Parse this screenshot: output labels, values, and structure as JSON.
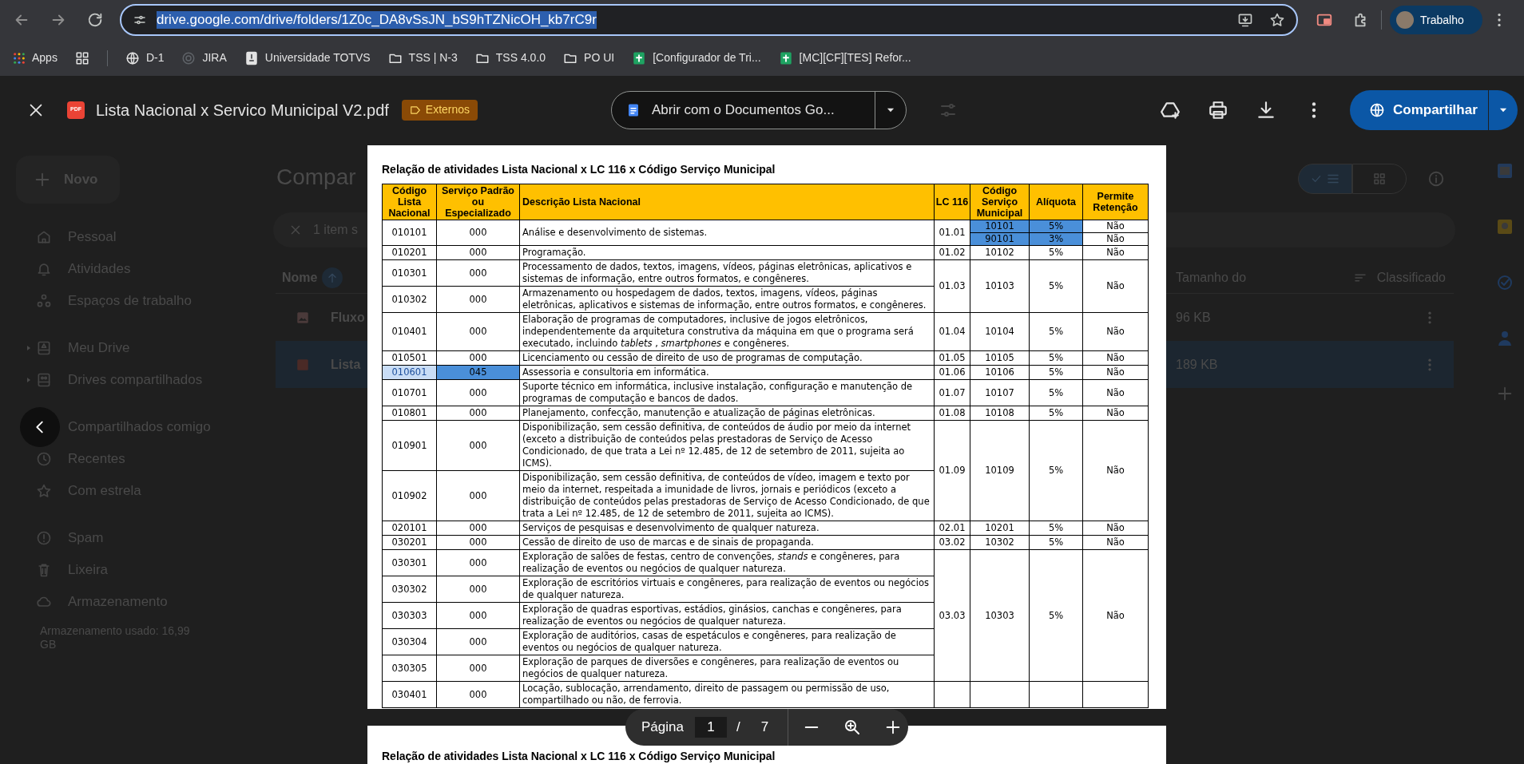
{
  "browser": {
    "url": "drive.google.com/drive/folders/1Z0c_DA8vSsJN_bS9hTZNicOH_kb7rC9r",
    "url_selected": true,
    "profile": "Trabalho"
  },
  "bookmarks": [
    {
      "kind": "apps",
      "label": "Apps"
    },
    {
      "kind": "grid"
    },
    {
      "kind": "globe",
      "label": "D-1"
    },
    {
      "kind": "site",
      "label": "JIRA"
    },
    {
      "kind": "page",
      "label": "Universidade TOTVS"
    },
    {
      "kind": "folder",
      "label": "TSS | N-3"
    },
    {
      "kind": "folder",
      "label": "TSS 4.0.0"
    },
    {
      "kind": "folder",
      "label": "PO UI"
    },
    {
      "kind": "sheet",
      "label": "[Configurador de Tri..."
    },
    {
      "kind": "sheet",
      "label": "[MC][CF][TES] Refor..."
    }
  ],
  "viewer": {
    "file_type": "PDF",
    "file_name": "Lista Nacional x Servico Municipal V2.pdf",
    "badge": "Externos",
    "open_with": "Abrir com o Documentos Go...",
    "share": "Compartilhar"
  },
  "drive": {
    "new_button": "Novo",
    "sections": [
      {
        "items": [
          {
            "label": "Pessoal",
            "kind": "home",
            "expandable": false
          },
          {
            "label": "Atividades",
            "kind": "bell",
            "expandable": false
          },
          {
            "label": "Espaços de trabalho",
            "kind": "circles",
            "expandable": false
          }
        ]
      },
      {
        "items": [
          {
            "label": "Meu Drive",
            "kind": "drive",
            "expandable": true
          },
          {
            "label": "Drives compartilhados",
            "kind": "shared",
            "expandable": true
          }
        ]
      },
      {
        "items": [
          {
            "label": "Compartilhados comigo",
            "kind": "covered",
            "expandable": false
          },
          {
            "label": "Recentes",
            "kind": "clock",
            "expandable": false
          },
          {
            "label": "Com estrela",
            "kind": "star",
            "expandable": false
          }
        ]
      },
      {
        "items": [
          {
            "label": "Spam",
            "kind": "alert",
            "expandable": false
          },
          {
            "label": "Lixeira",
            "kind": "trash",
            "expandable": false
          },
          {
            "label": "Armazenamento",
            "kind": "cloud",
            "expandable": false
          }
        ]
      }
    ],
    "storage_used": "Armazenamento usado: 16,99 GB",
    "page_title": "Compar",
    "selection": "1 item s",
    "views": [
      {
        "kind": "list",
        "selected": true
      },
      {
        "kind": "grid",
        "selected": false
      }
    ],
    "columns": [
      "Nome",
      "Tamanho do",
      "Classificado"
    ],
    "files": [
      {
        "name": "Fluxo",
        "kind": "image",
        "size": "96 KB",
        "selected": false
      },
      {
        "name": "Lista",
        "kind": "pdf",
        "size": "189 KB",
        "selected": true
      }
    ]
  },
  "pdf": {
    "pages": [
      {
        "title": "Relação de atividades Lista Nacional x LC 116 x Código Serviço Municipal",
        "table": {
          "columns": [
            "Código Lista Nacional",
            "Serviço Padrão ou Especializado",
            "Descrição Lista Nacional",
            "LC 116",
            "Código Serviço Municipal",
            "Alíquota",
            "Permite Retenção"
          ],
          "groups": [
            {
              "lc_116": "01.01",
              "items": [
                {
                  "codigo": "010101",
                  "codigo_highlighted": false,
                  "servico": "000",
                  "servico_highlighted": false,
                  "descricao": "Análise e desenvolvimento de sistemas."
                }
              ],
              "municipal": [
                {
                  "codigo": "10101",
                  "aliquota": "5%",
                  "permite_retencao": "Não",
                  "highlighted": true
                },
                {
                  "codigo": "90101",
                  "aliquota": "3%",
                  "permite_retencao": "Não",
                  "highlighted": true
                }
              ]
            },
            {
              "lc_116": "01.02",
              "items": [
                {
                  "codigo": "010201",
                  "codigo_highlighted": false,
                  "servico": "000",
                  "servico_highlighted": false,
                  "descricao": "Programação."
                }
              ],
              "municipal": [
                {
                  "codigo": "10102",
                  "aliquota": "5%",
                  "permite_retencao": "Não",
                  "highlighted": false
                }
              ]
            },
            {
              "lc_116": "01.03",
              "items": [
                {
                  "codigo": "010301",
                  "codigo_highlighted": false,
                  "servico": "000",
                  "servico_highlighted": false,
                  "descricao": "Processamento de dados, textos, imagens, vídeos, páginas eletrônicas, aplicativos e sistemas de informação, entre outros formatos, e congêneres."
                },
                {
                  "codigo": "010302",
                  "codigo_highlighted": false,
                  "servico": "000",
                  "servico_highlighted": false,
                  "descricao": "Armazenamento ou hospedagem de dados, textos, imagens, vídeos, páginas eletrônicas, aplicativos e sistemas de informação, entre outros formatos, e congêneres."
                }
              ],
              "municipal": [
                {
                  "codigo": "10103",
                  "aliquota": "5%",
                  "permite_retencao": "Não",
                  "highlighted": false
                }
              ]
            },
            {
              "lc_116": "01.04",
              "items": [
                {
                  "codigo": "010401",
                  "codigo_highlighted": false,
                  "servico": "000",
                  "servico_highlighted": false,
                  "descricao": "Elaboração de programas de computadores, inclusive de jogos eletrônicos, independentemente da arquitetura construtiva da máquina em que o programa será executado, incluindo *tablets* , *smartphones*  e congêneres."
                }
              ],
              "municipal": [
                {
                  "codigo": "10104",
                  "aliquota": "5%",
                  "permite_retencao": "Não",
                  "highlighted": false
                }
              ]
            },
            {
              "lc_116": "01.05",
              "items": [
                {
                  "codigo": "010501",
                  "codigo_highlighted": false,
                  "servico": "000",
                  "servico_highlighted": false,
                  "descricao": "Licenciamento ou cessão de direito de uso de programas de computação."
                }
              ],
              "municipal": [
                {
                  "codigo": "10105",
                  "aliquota": "5%",
                  "permite_retencao": "Não",
                  "highlighted": false
                }
              ]
            },
            {
              "lc_116": "01.06",
              "items": [
                {
                  "codigo": "010601",
                  "codigo_highlighted": true,
                  "servico": "045",
                  "servico_highlighted": true,
                  "descricao": "Assessoria e consultoria em informática."
                }
              ],
              "municipal": [
                {
                  "codigo": "10106",
                  "aliquota": "5%",
                  "permite_retencao": "Não",
                  "highlighted": false
                }
              ]
            },
            {
              "lc_116": "01.07",
              "items": [
                {
                  "codigo": "010701",
                  "codigo_highlighted": false,
                  "servico": "000",
                  "servico_highlighted": false,
                  "descricao": "Suporte técnico em informática, inclusive instalação, configuração e manutenção de programas de computação e bancos de dados."
                }
              ],
              "municipal": [
                {
                  "codigo": "10107",
                  "aliquota": "5%",
                  "permite_retencao": "Não",
                  "highlighted": false
                }
              ]
            },
            {
              "lc_116": "01.08",
              "items": [
                {
                  "codigo": "010801",
                  "codigo_highlighted": false,
                  "servico": "000",
                  "servico_highlighted": false,
                  "descricao": "Planejamento, confecção, manutenção e atualização de páginas eletrônicas."
                }
              ],
              "municipal": [
                {
                  "codigo": "10108",
                  "aliquota": "5%",
                  "permite_retencao": "Não",
                  "highlighted": false
                }
              ]
            },
            {
              "lc_116": "01.09",
              "items": [
                {
                  "codigo": "010901",
                  "codigo_highlighted": false,
                  "servico": "000",
                  "servico_highlighted": false,
                  "descricao": "Disponibilização, sem cessão definitiva, de conteúdos de áudio por meio da internet (exceto a distribuição de conteúdos pelas prestadoras de Serviço de Acesso Condicionado, de que trata a Lei nº 12.485, de 12 de setembro de 2011, sujeita ao ICMS)."
                },
                {
                  "codigo": "010902",
                  "codigo_highlighted": false,
                  "servico": "000",
                  "servico_highlighted": false,
                  "descricao": "Disponibilização, sem cessão definitiva, de conteúdos de vídeo, imagem e texto por meio da internet, respeitada a imunidade de livros, jornais e periódicos (exceto a distribuição de conteúdos pelas prestadoras de Serviço de Acesso Condicionado, de que trata a Lei nº 12.485, de 12 de setembro de 2011, sujeita ao ICMS)."
                }
              ],
              "municipal": [
                {
                  "codigo": "10109",
                  "aliquota": "5%",
                  "permite_retencao": "Não",
                  "highlighted": false
                }
              ]
            },
            {
              "lc_116": "02.01",
              "items": [
                {
                  "codigo": "020101",
                  "codigo_highlighted": false,
                  "servico": "000",
                  "servico_highlighted": false,
                  "descricao": "Serviços de pesquisas e desenvolvimento de qualquer natureza."
                }
              ],
              "municipal": [
                {
                  "codigo": "10201",
                  "aliquota": "5%",
                  "permite_retencao": "Não",
                  "highlighted": false
                }
              ]
            },
            {
              "lc_116": "03.02",
              "items": [
                {
                  "codigo": "030201",
                  "codigo_highlighted": false,
                  "servico": "000",
                  "servico_highlighted": false,
                  "descricao": "Cessão de direito de uso de marcas e de sinais de propaganda."
                }
              ],
              "municipal": [
                {
                  "codigo": "10302",
                  "aliquota": "5%",
                  "permite_retencao": "Não",
                  "highlighted": false
                }
              ]
            },
            {
              "lc_116": "03.03",
              "items": [
                {
                  "codigo": "030301",
                  "codigo_highlighted": false,
                  "servico": "000",
                  "servico_highlighted": false,
                  "descricao": "Exploração de salões de festas, centro de convenções, *stands*  e congêneres, para realização de eventos ou negócios de qualquer natureza."
                },
                {
                  "codigo": "030302",
                  "codigo_highlighted": false,
                  "servico": "000",
                  "servico_highlighted": false,
                  "descricao": "Exploração de escritórios virtuais e congêneres, para realização de eventos ou negócios de qualquer natureza."
                },
                {
                  "codigo": "030303",
                  "codigo_highlighted": false,
                  "servico": "000",
                  "servico_highlighted": false,
                  "descricao": "Exploração de quadras esportivas, estádios, ginásios, canchas e congêneres, para realização de eventos ou negócios de qualquer natureza."
                },
                {
                  "codigo": "030304",
                  "codigo_highlighted": false,
                  "servico": "000",
                  "servico_highlighted": false,
                  "descricao": "Exploração de auditórios, casas de espetáculos e congêneres, para realização de eventos ou negócios de qualquer natureza."
                },
                {
                  "codigo": "030305",
                  "codigo_highlighted": false,
                  "servico": "000",
                  "servico_highlighted": false,
                  "descricao": "Exploração de parques de diversões e congêneres, para realização de eventos ou negócios de qualquer natureza."
                }
              ],
              "municipal": [
                {
                  "codigo": "10303",
                  "aliquota": "5%",
                  "permite_retencao": "Não",
                  "highlighted": false
                }
              ]
            },
            {
              "items": [
                {
                  "codigo": "030401",
                  "codigo_highlighted": false,
                  "servico": "000",
                  "servico_highlighted": false,
                  "descricao": "Locação, sublocação, arrendamento, direito de passagem ou permissão de uso, compartilhado ou não, de ferrovia."
                }
              ]
            }
          ]
        }
      },
      {
        "title": "Relação de atividades Lista Nacional x LC 116 x Código Serviço Municipal"
      }
    ],
    "page_nav": {
      "label": "Página",
      "current": "1",
      "separator": "/",
      "total": "7"
    }
  }
}
